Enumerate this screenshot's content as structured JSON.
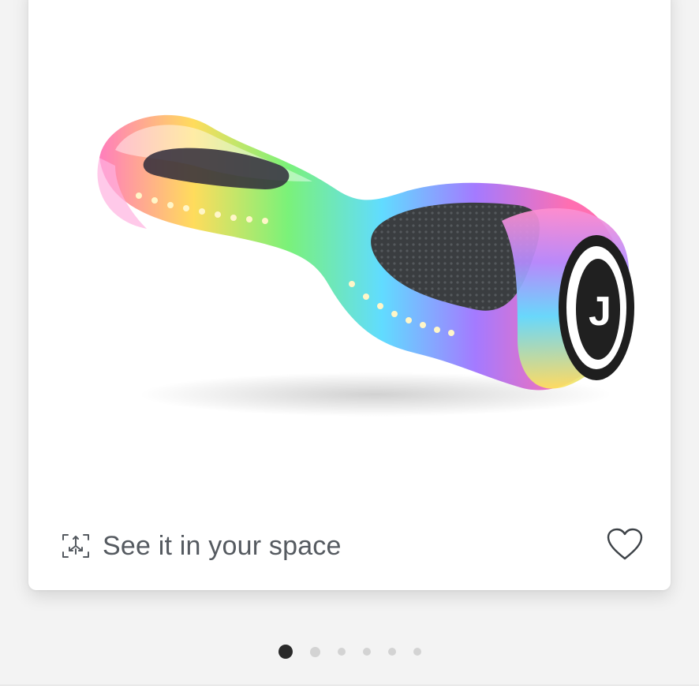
{
  "product": {
    "image_alt": "Rainbow LED hoverboard",
    "ar_label": "See it in your space",
    "ar_icon": "ar-cube-icon",
    "favorite_icon": "heart-outline-icon"
  },
  "carousel": {
    "total": 6,
    "active_index": 0
  },
  "colors": {
    "active_dot": "#2a2a2a",
    "inactive_dot": "#d3d3d3",
    "label_text": "#555a60"
  }
}
